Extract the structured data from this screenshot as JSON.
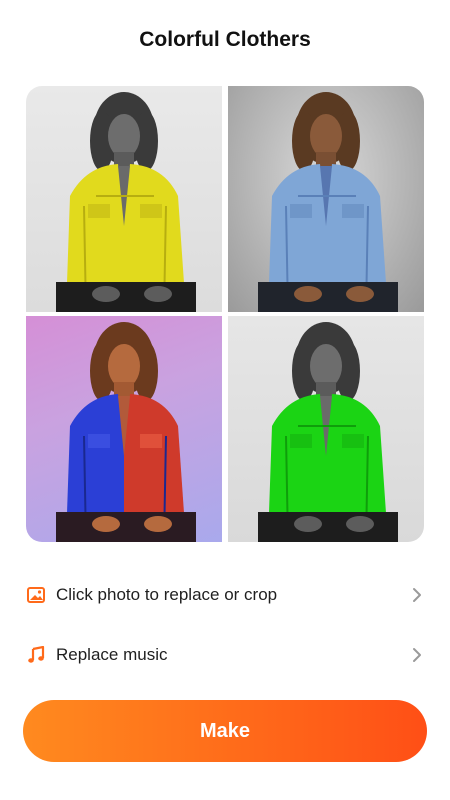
{
  "header": {
    "title": "Colorful Clothers"
  },
  "photos": [
    {
      "name": "yellow",
      "jacket_color": "#e8e020",
      "background": "light-gray"
    },
    {
      "name": "blue",
      "jacket_color": "#7fa6d6",
      "background": "gray"
    },
    {
      "name": "blue-red",
      "jacket_color": "#2a40d8",
      "jacket_color_secondary": "#d63a2a",
      "background": "pink-purple"
    },
    {
      "name": "green",
      "jacket_color": "#19d414",
      "background": "light-gray"
    }
  ],
  "options": {
    "replace_photo": {
      "label": "Click photo to replace or crop",
      "icon": "image-icon",
      "color": "#ff6a1a"
    },
    "replace_music": {
      "label": "Replace music",
      "icon": "music-note-icon",
      "color": "#ff6a1a"
    }
  },
  "make_button": {
    "label": "Make",
    "gradient_start": "#ff8a1f",
    "gradient_end": "#ff4f16"
  }
}
